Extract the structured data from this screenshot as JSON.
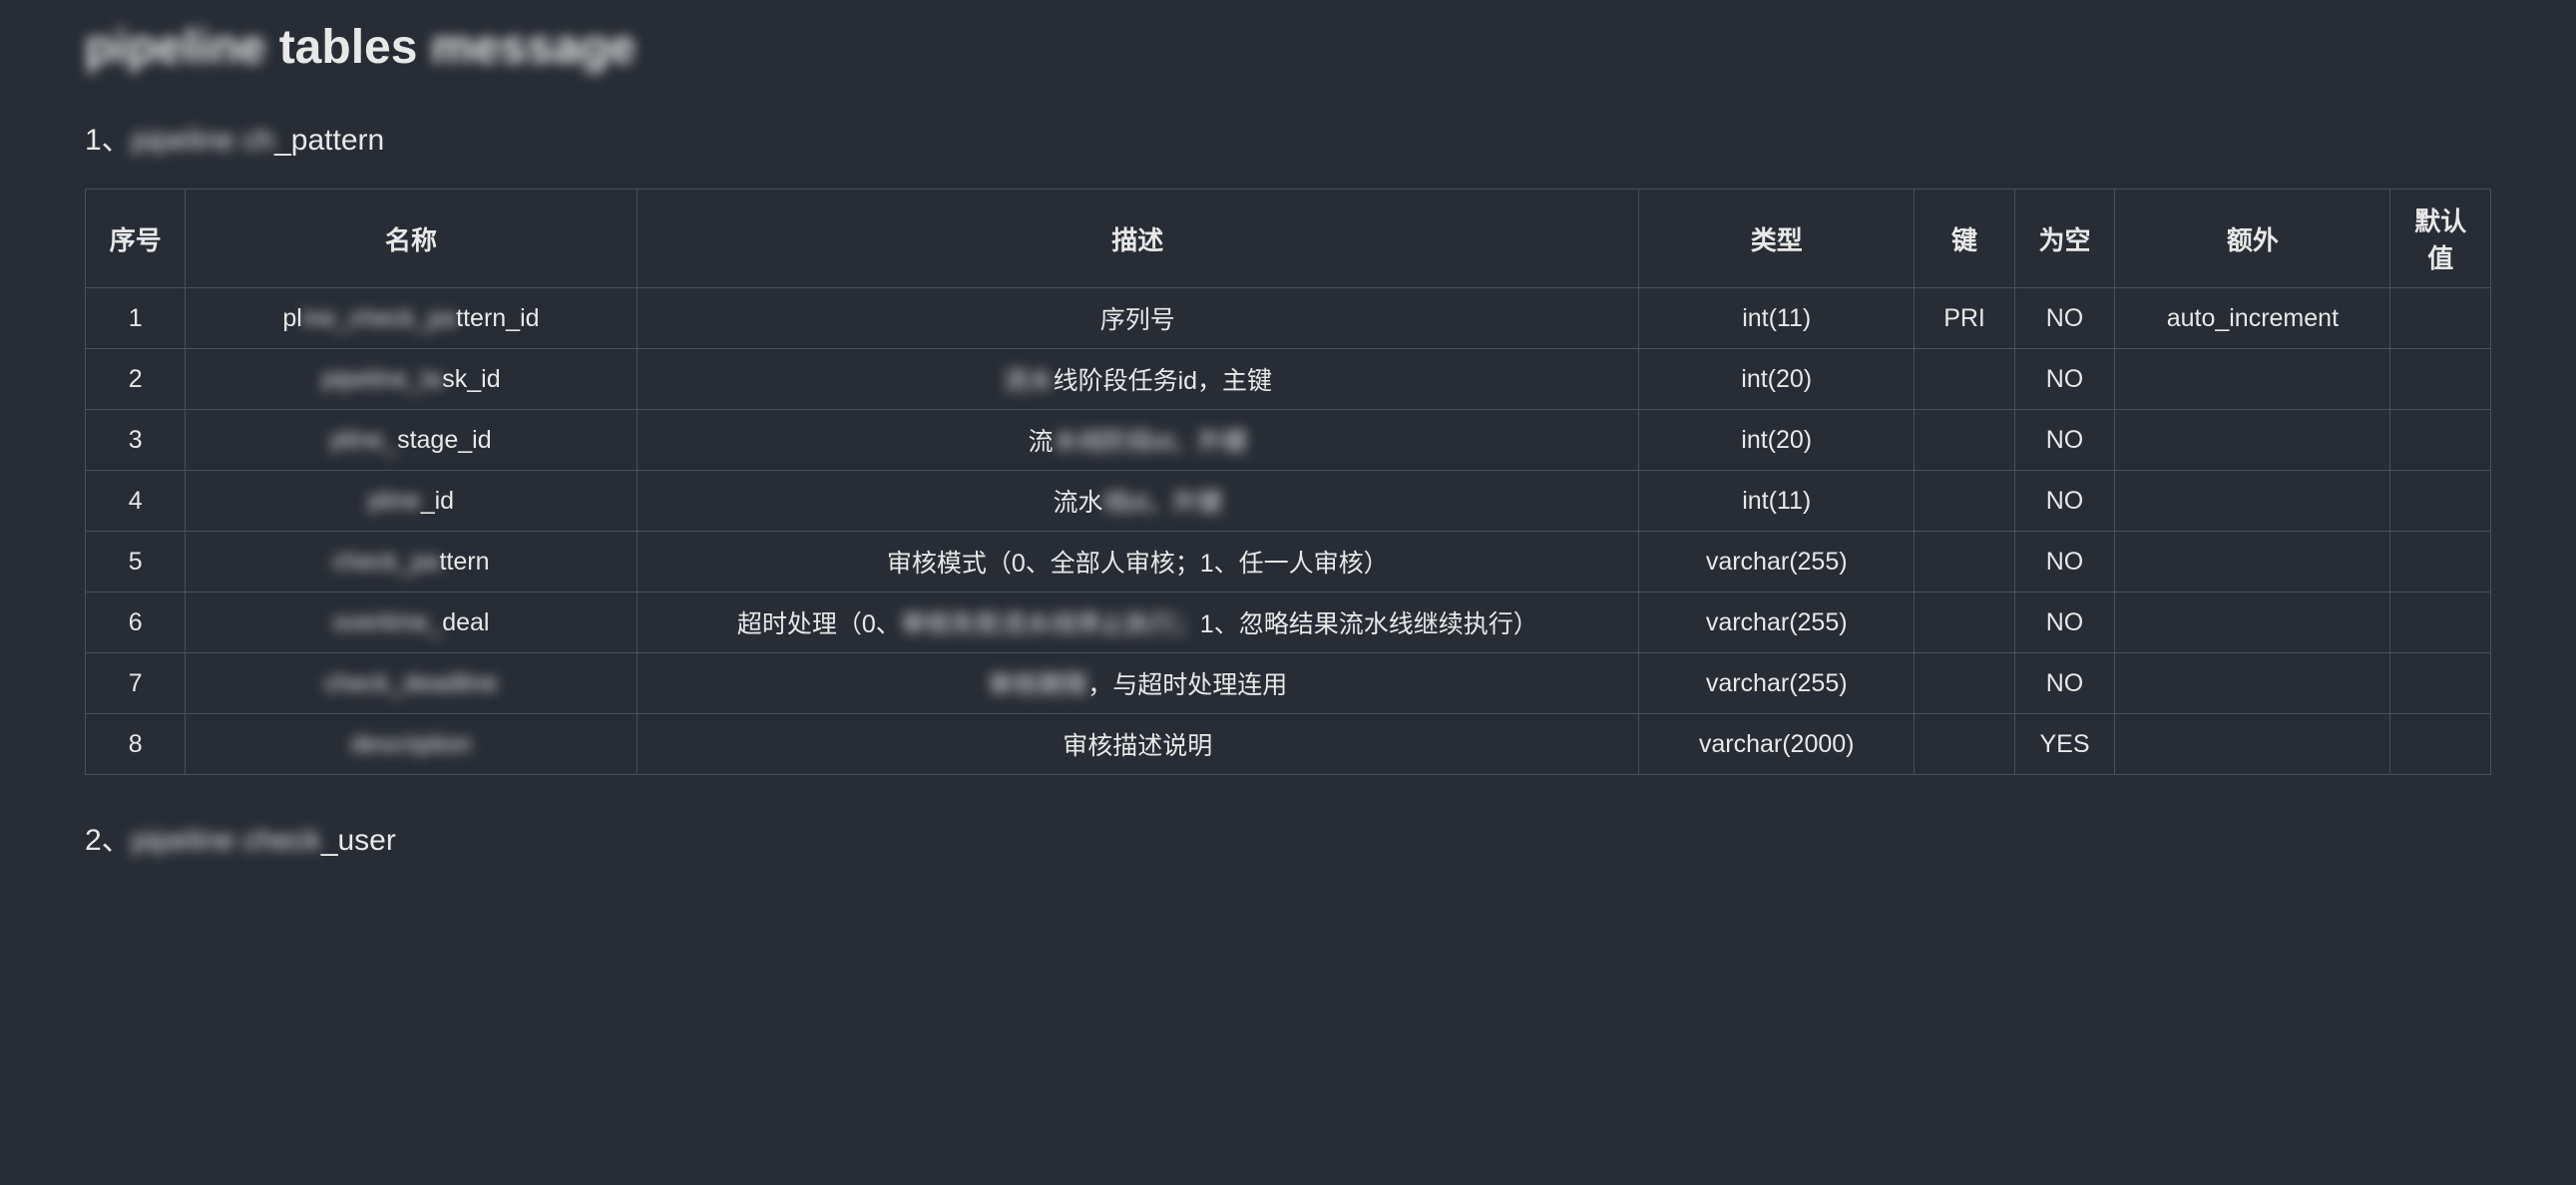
{
  "pageTitle": {
    "prefix": "pipeline",
    "middle": " tables ",
    "suffix": "message"
  },
  "section1": {
    "prefix": "1、",
    "blurred1": "pipeline ch",
    "middle": "_pattern",
    "label": "pipeline_check_pattern"
  },
  "section2": {
    "prefix": "2、",
    "blurred1": "pipeline check",
    "suffix": "_user",
    "label": "pipeline_check_user"
  },
  "table": {
    "headers": {
      "seq": "序号",
      "name": "名称",
      "desc": "描述",
      "type": "类型",
      "key": "键",
      "null": "为空",
      "extra": "额外",
      "default": "默认值"
    },
    "rows": [
      {
        "seq": "1",
        "name_prefix": "pl",
        "name_blur": "ine_check_pa",
        "name_suffix": "ttern_id",
        "desc": "序列号",
        "type": "int(11)",
        "key": "PRI",
        "null": "NO",
        "extra": "auto_increment",
        "default": ""
      },
      {
        "seq": "2",
        "name_prefix": "",
        "name_blur": "pipeline_ta",
        "name_suffix": "sk_id",
        "desc_blur": "流水",
        "desc": "线阶段任务id，主键",
        "type": "int(20)",
        "key": "",
        "null": "NO",
        "extra": "",
        "default": ""
      },
      {
        "seq": "3",
        "name_prefix": "",
        "name_blur": "pline_",
        "name_suffix": "stage_id",
        "desc_prefix": "流",
        "desc_blur": "水线阶段id，外键",
        "desc_suffix": "",
        "type": "int(20)",
        "key": "",
        "null": "NO",
        "extra": "",
        "default": ""
      },
      {
        "seq": "4",
        "name_prefix": "",
        "name_blur": "pline",
        "name_suffix": "_id",
        "desc_prefix": "流水",
        "desc_blur": "线id，外键",
        "desc_suffix": "",
        "type": "int(11)",
        "key": "",
        "null": "NO",
        "extra": "",
        "default": ""
      },
      {
        "seq": "5",
        "name_prefix": "",
        "name_blur": "check_pa",
        "name_suffix": "ttern",
        "desc": "审核模式（0、全部人审核；1、任一人审核）",
        "type": "varchar(255)",
        "key": "",
        "null": "NO",
        "extra": "",
        "default": ""
      },
      {
        "seq": "6",
        "name_prefix": "",
        "name_blur": "overtime_",
        "name_suffix": "deal",
        "desc_prefix": "超时处理（0、",
        "desc_blur": "审核失败流水线停止执行；",
        "desc_suffix": "1、忽略结果流水线继续执行）",
        "type": "varchar(255)",
        "key": "",
        "null": "NO",
        "extra": "",
        "default": ""
      },
      {
        "seq": "7",
        "name_prefix": "",
        "name_blur": "check_deadline",
        "name_suffix": "",
        "desc_prefix": "",
        "desc_blur": "审核期限",
        "desc_suffix": "，与超时处理连用",
        "type": "varchar(255)",
        "key": "",
        "null": "NO",
        "extra": "",
        "default": ""
      },
      {
        "seq": "8",
        "name_prefix": "",
        "name_blur": "description",
        "name_suffix": "",
        "desc": "审核描述说明",
        "type": "varchar(2000)",
        "key": "",
        "null": "YES",
        "extra": "",
        "default": ""
      }
    ]
  }
}
